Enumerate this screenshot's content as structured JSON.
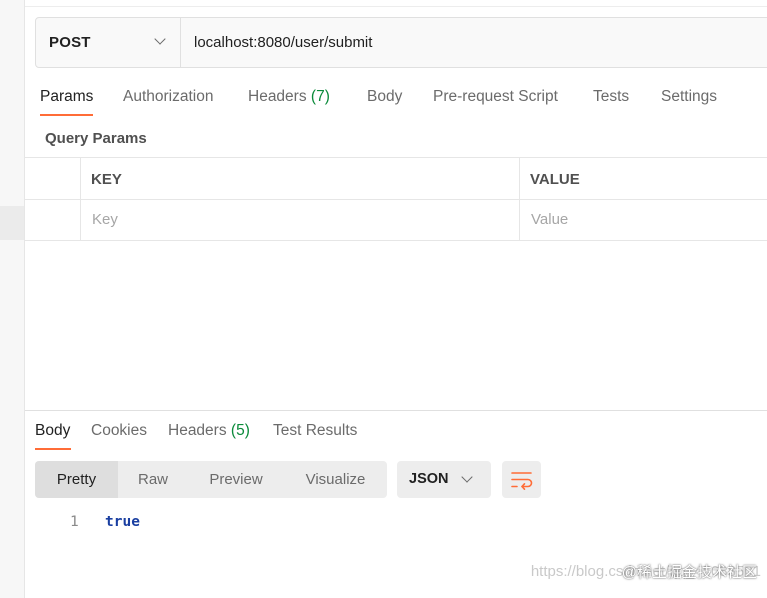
{
  "request": {
    "method": "POST",
    "url": "localhost:8080/user/submit"
  },
  "request_tabs": [
    {
      "label": "Params",
      "count": ""
    },
    {
      "label": "Authorization",
      "count": ""
    },
    {
      "label": "Headers",
      "count": "(7)"
    },
    {
      "label": "Body",
      "count": ""
    },
    {
      "label": "Pre-request Script",
      "count": ""
    },
    {
      "label": "Tests",
      "count": ""
    },
    {
      "label": "Settings",
      "count": ""
    }
  ],
  "params": {
    "title": "Query Params",
    "columns": [
      "KEY",
      "VALUE"
    ],
    "placeholders": [
      "Key",
      "Value"
    ]
  },
  "response_tabs": [
    {
      "label": "Body",
      "count": ""
    },
    {
      "label": "Cookies",
      "count": ""
    },
    {
      "label": "Headers",
      "count": "(5)"
    },
    {
      "label": "Test Results",
      "count": ""
    }
  ],
  "view_modes": [
    "Pretty",
    "Raw",
    "Preview",
    "Visualize"
  ],
  "format": "JSON",
  "response_body": [
    {
      "line": "1",
      "text": "true"
    }
  ],
  "watermark": {
    "url": "https://blog.csdn.net/qq_45088501",
    "site": "@稀土掘金技术社区"
  },
  "icons": {
    "method_dropdown": "chevron-down-icon",
    "format_dropdown": "chevron-down-icon",
    "wrap": "wrap-lines-icon"
  },
  "colors": {
    "accent": "#ff6c37",
    "count_green": "#0a8a3a",
    "code_blue": "#1a3fa1"
  }
}
